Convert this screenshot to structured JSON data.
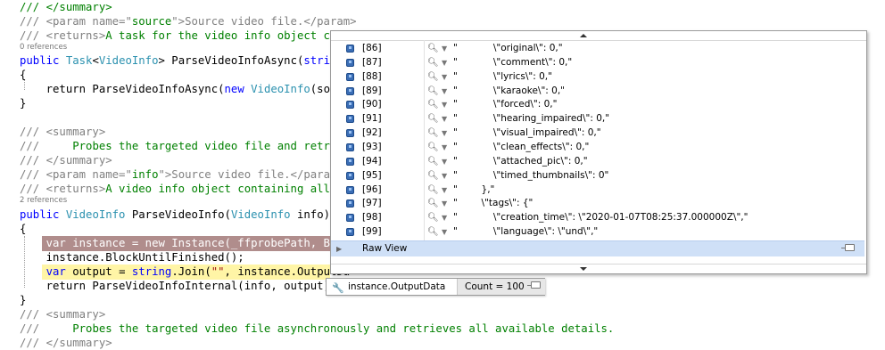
{
  "code": {
    "l1": "/// </summary>",
    "l2a": "/// <param name=\"",
    "l2b": "source",
    "l2c": "\">Source video file.</param>",
    "l3a": "/// <returns>",
    "l3b": "A task for the video info object cont",
    "refs1": "0 references",
    "l4a": "public ",
    "l4b": "Task",
    "l4c": "<",
    "l4d": "VideoInfo",
    "l4e": "> ParseVideoInfoAsync(",
    "l4f": "string",
    "l5": "{",
    "l6a": "    return ParseVideoInfoAsync(",
    "l6b": "new ",
    "l6c": "VideoInfo",
    "l6d": "(sourc",
    "l7": "}",
    "l8": "/// <summary>",
    "l9a": "///     ",
    "l9b": "Probes the targeted video file and retriev",
    "l10": "/// </summary>",
    "l11a": "/// <param name=\"",
    "l11b": "info",
    "l11c": "\">Source video file.</param>",
    "l12a": "/// <returns>",
    "l12b": "A video info object containing all de",
    "refs2": "2 references",
    "l13a": "public ",
    "l13b": "VideoInfo",
    "l13c": " ParseVideoInfo(",
    "l13d": "VideoInfo",
    "l13e": " info)",
    "l14": "{",
    "l15": "    var instance = new Instance(_ffprobePath, Buil",
    "l16": "    instance.BlockUntilFinished();",
    "l17a": "    ",
    "l17b": "var",
    "l17c": " output = ",
    "l17d": "string",
    "l17e": ".Join(",
    "l17f": "\"\"",
    "l17g": ", instance.OutputDa",
    "l18a": "    return ParseVideoInfoInternal(info, output)",
    "l19": "}",
    "l20": "/// <summary>",
    "l21a": "///     ",
    "l21b": "Probes the targeted video file asynchronously and retrieves all available details.",
    "l22": "/// </summary>"
  },
  "datatip": {
    "rows": [
      {
        "name": "[86]",
        "value": "\"            \\\"original\\\": 0,\""
      },
      {
        "name": "[87]",
        "value": "\"            \\\"comment\\\": 0,\""
      },
      {
        "name": "[88]",
        "value": "\"            \\\"lyrics\\\": 0,\""
      },
      {
        "name": "[89]",
        "value": "\"            \\\"karaoke\\\": 0,\""
      },
      {
        "name": "[90]",
        "value": "\"            \\\"forced\\\": 0,\""
      },
      {
        "name": "[91]",
        "value": "\"            \\\"hearing_impaired\\\": 0,\""
      },
      {
        "name": "[92]",
        "value": "\"            \\\"visual_impaired\\\": 0,\""
      },
      {
        "name": "[93]",
        "value": "\"            \\\"clean_effects\\\": 0,\""
      },
      {
        "name": "[94]",
        "value": "\"            \\\"attached_pic\\\": 0,\""
      },
      {
        "name": "[95]",
        "value": "\"            \\\"timed_thumbnails\\\": 0\""
      },
      {
        "name": "[96]",
        "value": "\"        },\""
      },
      {
        "name": "[97]",
        "value": "\"        \\\"tags\\\": {\""
      },
      {
        "name": "[98]",
        "value": "\"            \\\"creation_time\\\": \\\"2020-01-07T08:25:37.000000Z\\\",\""
      },
      {
        "name": "[99]",
        "value": "\"            \\\"language\\\": \\\"und\\\",\""
      }
    ],
    "raw_view_label": "Raw View",
    "row_icons": [
      "cube-icon",
      "magnifier-icon",
      "dropdown-arrow-icon"
    ]
  },
  "hovertip": {
    "expression": "instance.OutputData",
    "count": "Count = 100"
  },
  "colors": {
    "comment": "#008000",
    "keyword": "#0000ff",
    "type": "#2b91af",
    "string": "#a31515",
    "breakpoint_line": "#b08d8c",
    "current_line": "#fff5a6",
    "raw_view_bg": "#cfe0f7"
  }
}
